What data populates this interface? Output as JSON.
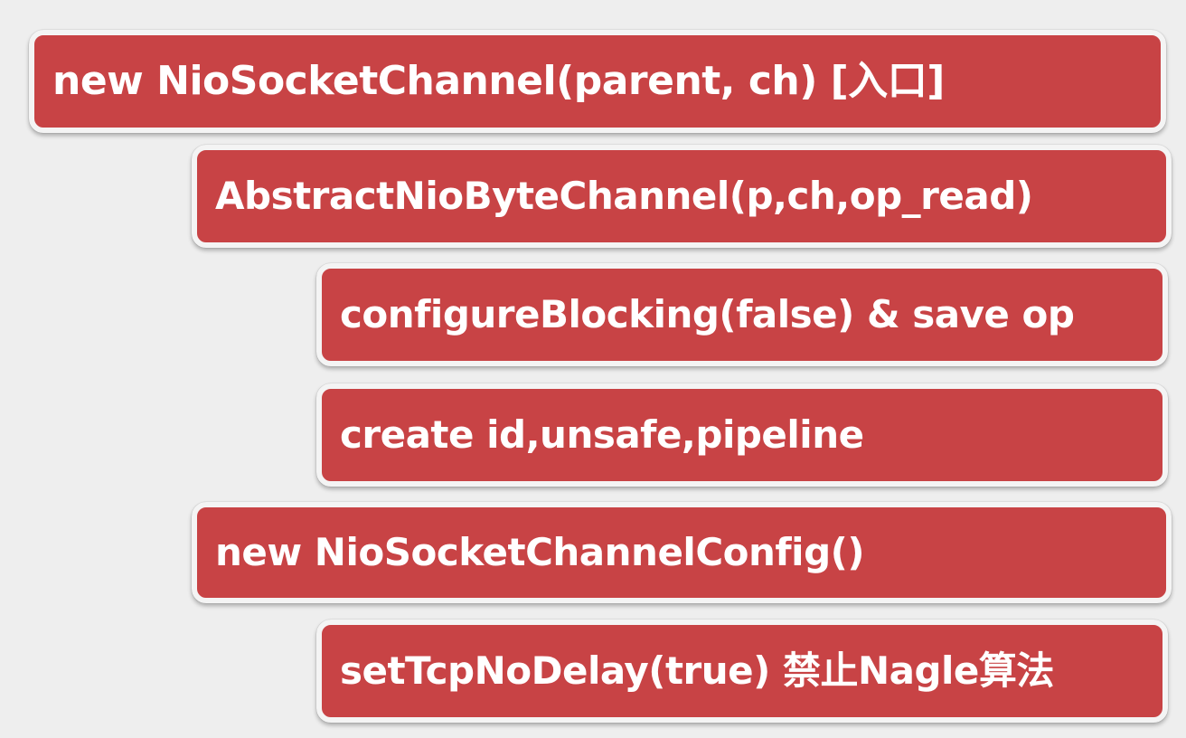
{
  "steps": [
    {
      "label": "new NioSocketChannel(parent, ch) [入口]",
      "level": 0
    },
    {
      "label": "AbstractNioByteChannel(p,ch,op_read)",
      "level": 1
    },
    {
      "label": "configureBlocking(false) & save op",
      "level": 2
    },
    {
      "label": "create id,unsafe,pipeline",
      "level": 2
    },
    {
      "label": "new NioSocketChannelConfig()",
      "level": 1
    },
    {
      "label": "setTcpNoDelay(true) 禁止Nagle算法",
      "level": 2
    }
  ],
  "colors": {
    "box_fill": "#c84345",
    "box_border": "#f4f4f4",
    "text": "#ffffff",
    "background": "#eeeeee"
  }
}
